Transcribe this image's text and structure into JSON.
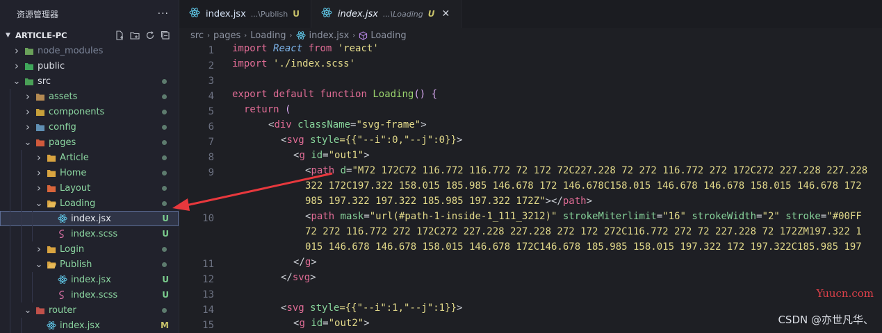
{
  "explorer": {
    "title": "资源管理器",
    "more": "···",
    "project": "ARTICLE-PC",
    "tree": [
      {
        "label": "node_modules",
        "status": "",
        "color": "#7c8599"
      },
      {
        "label": "public",
        "status": "",
        "color": "#d8dbe2"
      },
      {
        "label": "src",
        "status": "dot",
        "color": "#d8dbe2"
      },
      {
        "label": "assets",
        "status": "dot",
        "color": "#8bd5a0"
      },
      {
        "label": "components",
        "status": "dot",
        "color": "#8bd5a0"
      },
      {
        "label": "config",
        "status": "dot",
        "color": "#8bd5a0"
      },
      {
        "label": "pages",
        "status": "dot",
        "color": "#8bd5a0"
      },
      {
        "label": "Article",
        "status": "dot",
        "color": "#8bd5a0"
      },
      {
        "label": "Home",
        "status": "dot",
        "color": "#8bd5a0"
      },
      {
        "label": "Layout",
        "status": "dot",
        "color": "#8bd5a0"
      },
      {
        "label": "Loading",
        "status": "dot",
        "color": "#8bd5a0"
      },
      {
        "label": "index.jsx",
        "status": "U",
        "color": "#e7eaf0"
      },
      {
        "label": "index.scss",
        "status": "U",
        "color": "#8bd5a0"
      },
      {
        "label": "Login",
        "status": "dot",
        "color": "#8bd5a0"
      },
      {
        "label": "Publish",
        "status": "dot",
        "color": "#8bd5a0"
      },
      {
        "label": "index.jsx",
        "status": "U",
        "color": "#8bd5a0"
      },
      {
        "label": "index.scss",
        "status": "U",
        "color": "#8bd5a0"
      },
      {
        "label": "router",
        "status": "dot",
        "color": "#8bd5a0"
      },
      {
        "label": "index.jsx",
        "status": "M",
        "color": "#8bd5a0"
      }
    ]
  },
  "tabs": [
    {
      "name": "index.jsx",
      "path": "...\\Publish",
      "status": "U"
    },
    {
      "name": "index.jsx",
      "path": "...\\Loading",
      "status": "U",
      "close": "✕"
    }
  ],
  "breadcrumb": [
    "src",
    "pages",
    "Loading",
    "index.jsx",
    "Loading"
  ],
  "line_numbers": [
    "1",
    "2",
    "3",
    "4",
    "5",
    "6",
    "7",
    "8",
    "9",
    "",
    "",
    "10",
    "",
    "",
    "11",
    "12",
    "13",
    "14",
    "15"
  ],
  "code": {
    "l1_import": "import",
    "l1_react": "React",
    "l1_from": "from",
    "l1_str": "'react'",
    "l2_import": "import",
    "l2_str": "'./index.scss'",
    "l4_export": "export",
    "l4_default": "default",
    "l4_function": "function",
    "l4_name": "Loading",
    "l4_rest": "() {",
    "l5_return": "return",
    "l5_paren": " (",
    "l6_a": "<",
    "l6_tag": "div",
    "l6_attr": "className",
    "l6_eq": "=",
    "l6_val": "\"svg-frame\"",
    "l6_b": ">",
    "l7_tag": "svg",
    "l7_attr": "style",
    "l7_val": "={{\"--i\":0,\"--j\":0}}",
    "l8_tag": "g",
    "l8_attr": "id",
    "l8_val": "\"out1\"",
    "l9_tag": "path",
    "l9_attr": "d",
    "l9_val": "\"M72 172C72 116.772 116.772 72 172 72C227.228 72 272 116.772 272 172C272 227.228 227.228",
    "l9b": "322 172C197.322 158.015 185.985 146.678 172 146.678C158.015 146.678 146.678 158.015 146.678 172",
    "l9c_val": "985 197.322 197.322 185.985 197.322 172Z\"",
    "l9c_end": "></",
    "l9c_tag": "path",
    "l10_tag": "path",
    "l10_a1": "mask",
    "l10_v1": "\"url(#path-1-inside-1_111_3212)\"",
    "l10_a2": "strokeMiterlimit",
    "l10_v2": "\"16\"",
    "l10_a3": "strokeWidth",
    "l10_v3": "\"2\"",
    "l10_a4": "stroke",
    "l10_v4": "\"#00FF",
    "l10b": "72 272 116.772 272 172C272 227.228 227.228 272 172 272C116.772 272 72 227.228 72 172ZM197.322 1",
    "l10c": "015 146.678 146.678 158.015 146.678 172C146.678 185.985 158.015 197.322 172 197.322C185.985 197",
    "l11_tag": "g",
    "l12_tag": "svg",
    "l14_tag": "svg",
    "l14_attr": "style",
    "l14_val": "={{\"--i\":1,\"--j\":1}}",
    "l15_tag": "g",
    "l15_attr": "id",
    "l15_val": "\"out2\""
  },
  "watermark": {
    "site": "Yuucn.com",
    "author": "CSDN @亦世凡华、"
  }
}
